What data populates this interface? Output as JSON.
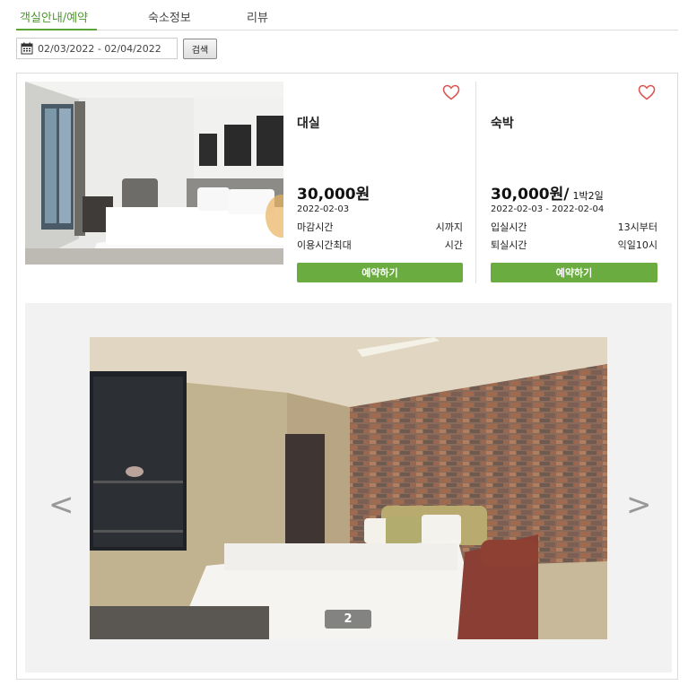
{
  "tabs": [
    {
      "label": "객실안내/예약",
      "active": true
    },
    {
      "label": "숙소정보",
      "active": false
    },
    {
      "label": "리뷰",
      "active": false
    }
  ],
  "search": {
    "date_range": "02/03/2022 - 02/04/2022",
    "button_label": "검색",
    "icon": "calendar-icon"
  },
  "plans": [
    {
      "name": "대실",
      "price": "30,000원",
      "date": "2022-02-03",
      "rows": [
        {
          "label": "마감시간",
          "value": "시까지"
        },
        {
          "label": "이용시간최대",
          "value": "시간"
        }
      ],
      "button_label": "예약하기"
    },
    {
      "name": "숙박",
      "price": "30,000원/",
      "price_sub": "1박2일",
      "date": "2022-02-03 - 2022-02-04",
      "rows": [
        {
          "label": "입실시간",
          "value": "13시부터"
        },
        {
          "label": "퇴실시간",
          "value": "익일10시"
        }
      ],
      "button_label": "예약하기"
    }
  ],
  "gallery": {
    "prev": "<",
    "next": ">",
    "page": "2"
  },
  "colors": {
    "accent": "#5aa537",
    "button": "#6aac3f",
    "heart": "#d9534f"
  }
}
